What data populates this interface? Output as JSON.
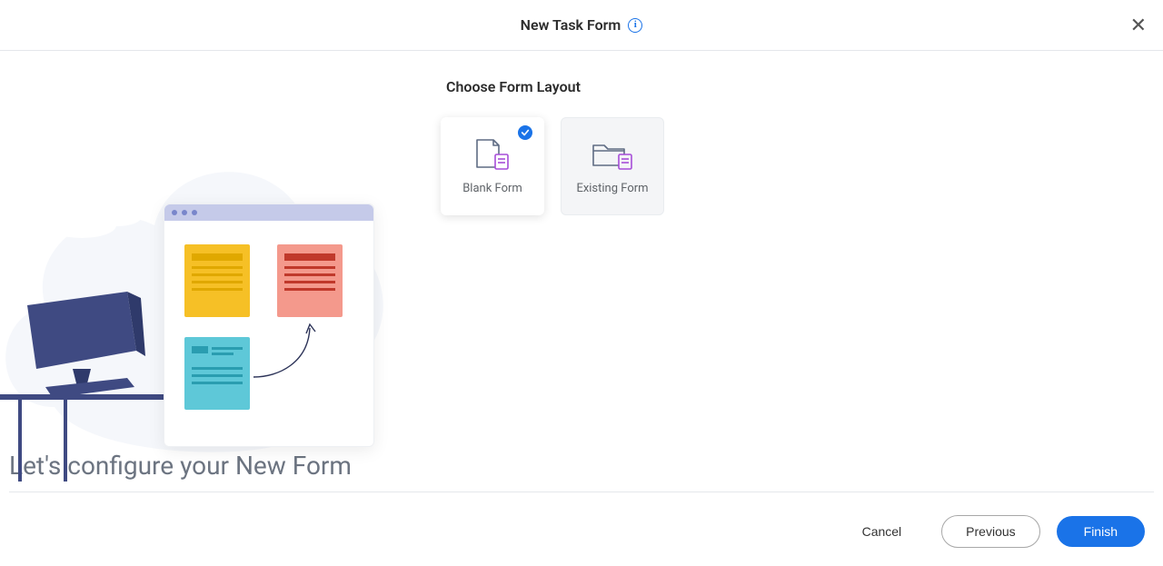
{
  "header": {
    "title": "New Task Form"
  },
  "layout_chooser": {
    "title": "Choose Form Layout",
    "options": {
      "blank": {
        "label": "Blank Form",
        "selected": true
      },
      "existing": {
        "label": "Existing Form",
        "selected": false
      }
    }
  },
  "configure": {
    "title": "Let's configure your New Form"
  },
  "footer": {
    "cancel": "Cancel",
    "previous": "Previous",
    "finish": "Finish"
  }
}
